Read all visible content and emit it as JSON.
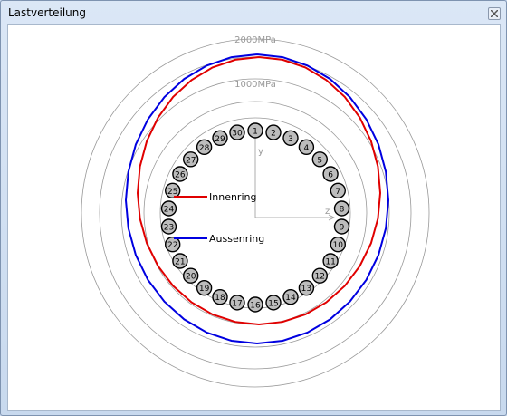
{
  "window": {
    "title": "Lastverteilung"
  },
  "chart_data": {
    "type": "polar-load-distribution",
    "ring_labels": [
      "2000MPa",
      "1000MPa"
    ],
    "axes": {
      "y": "y",
      "z": "z"
    },
    "balls": [
      "1",
      "2",
      "3",
      "4",
      "5",
      "6",
      "7",
      "8",
      "9",
      "10",
      "11",
      "12",
      "13",
      "14",
      "15",
      "16",
      "17",
      "18",
      "19",
      "20",
      "21",
      "22",
      "23",
      "24",
      "25",
      "26",
      "27",
      "28",
      "29",
      "30"
    ],
    "legend": [
      {
        "name": "Innenring",
        "color": "#e00000"
      },
      {
        "name": "Aussenring",
        "color": "#0000e0"
      }
    ]
  }
}
